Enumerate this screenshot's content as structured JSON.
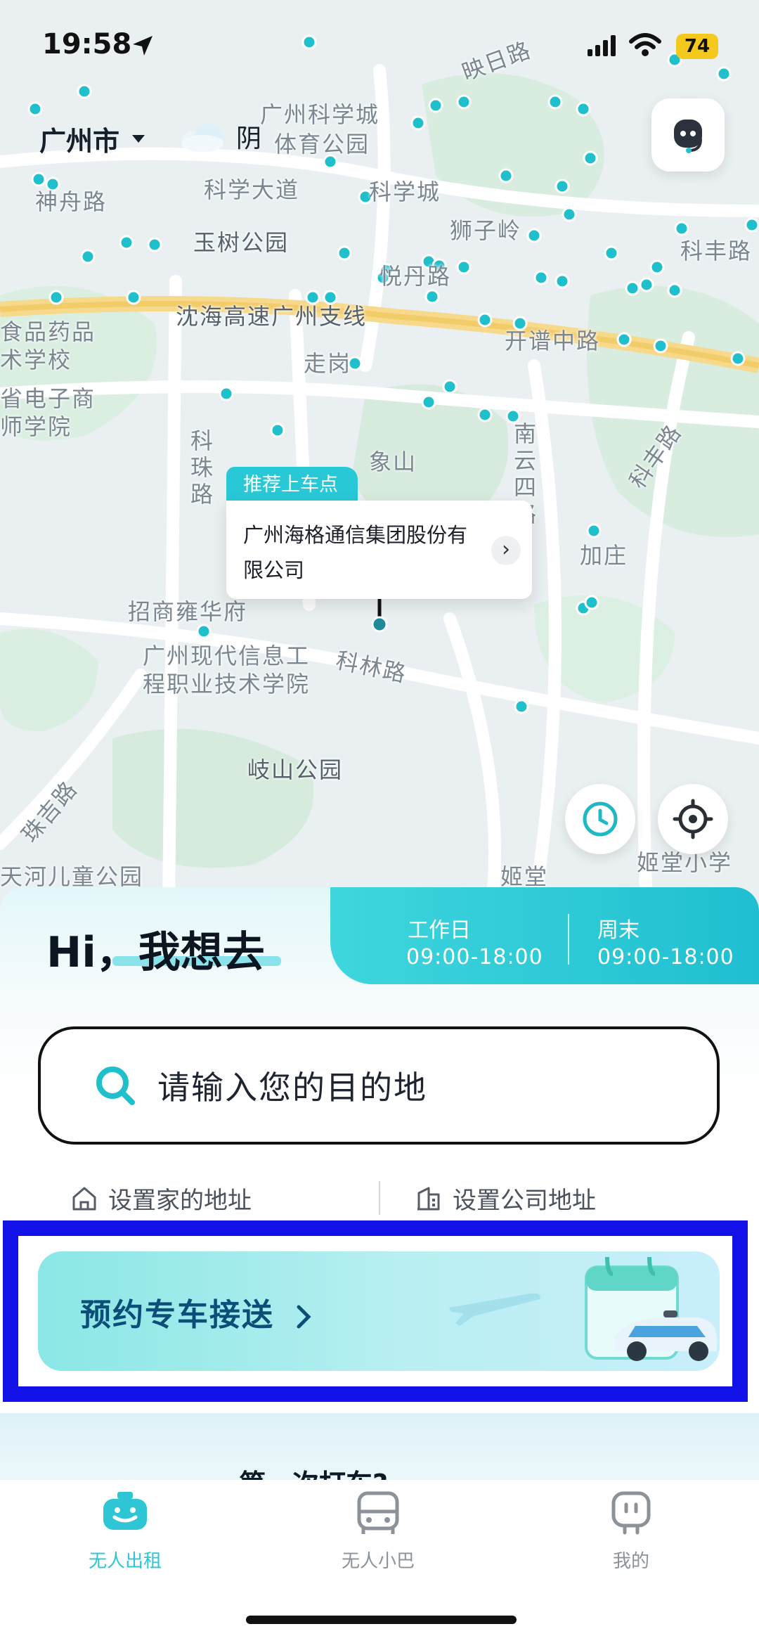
{
  "status_bar": {
    "time": "19:58",
    "battery": "74"
  },
  "header": {
    "city": "广州市",
    "weather": "阴"
  },
  "map": {
    "labels": {
      "kexuecheng_sports": "广州科学城",
      "kexuecheng_sports2": "体育公园",
      "shenzhou": "神舟路",
      "kexue_dadao": "科学大道",
      "kexuecheng": "科学城",
      "shiziling": "狮子岭",
      "kefeng_lu": "科丰路",
      "yushu": "玉树公园",
      "yuedan": "悦丹路",
      "expressway": "沈海高速广州支线",
      "kaipu": "开谱中路",
      "food": "食品药品",
      "food2": "术学校",
      "electronic": "省电子商",
      "electronic2": "师学院",
      "zougang": "走岗",
      "kezhu": "科珠路",
      "xiangshan": "象山",
      "nanyun": "南云四路",
      "kefeng2": "科丰路",
      "jiazhuang": "加庄",
      "zhaoshang": "招商雍华府",
      "modern1": "广州现代信息工",
      "modern2": "程职业技术学院",
      "kelin": "科林路",
      "qishan": "岐山公园",
      "zhuji": "珠吉路",
      "children": "天河儿童公园",
      "jitang": "姬堂",
      "jitang_school": "姬堂小学",
      "yingri": "映日路"
    },
    "pickup": {
      "tag": "推荐上车点",
      "place": "广州海格通信集团股份有限公司"
    }
  },
  "sheet": {
    "greeting": "Hi，我想去",
    "hours": {
      "weekday_label": "工作日",
      "weekday_time": "09:00-18:00",
      "weekend_label": "周末",
      "weekend_time": "09:00-18:00"
    },
    "search_placeholder": "请输入您的目的地",
    "home_address": "设置家的地址",
    "company_address": "设置公司地址",
    "banner_title": "预约专车接送",
    "promo_text": "第一次打车?"
  },
  "tabs": [
    {
      "label": "无人出租",
      "icon": "taxi-icon",
      "active": true
    },
    {
      "label": "无人小巴",
      "icon": "bus-icon",
      "active": false
    },
    {
      "label": "我的",
      "icon": "profile-icon",
      "active": false
    }
  ],
  "colors": {
    "accent": "#28c8d6",
    "highlight": "#1212e8",
    "banner_text": "#0b4f78"
  }
}
